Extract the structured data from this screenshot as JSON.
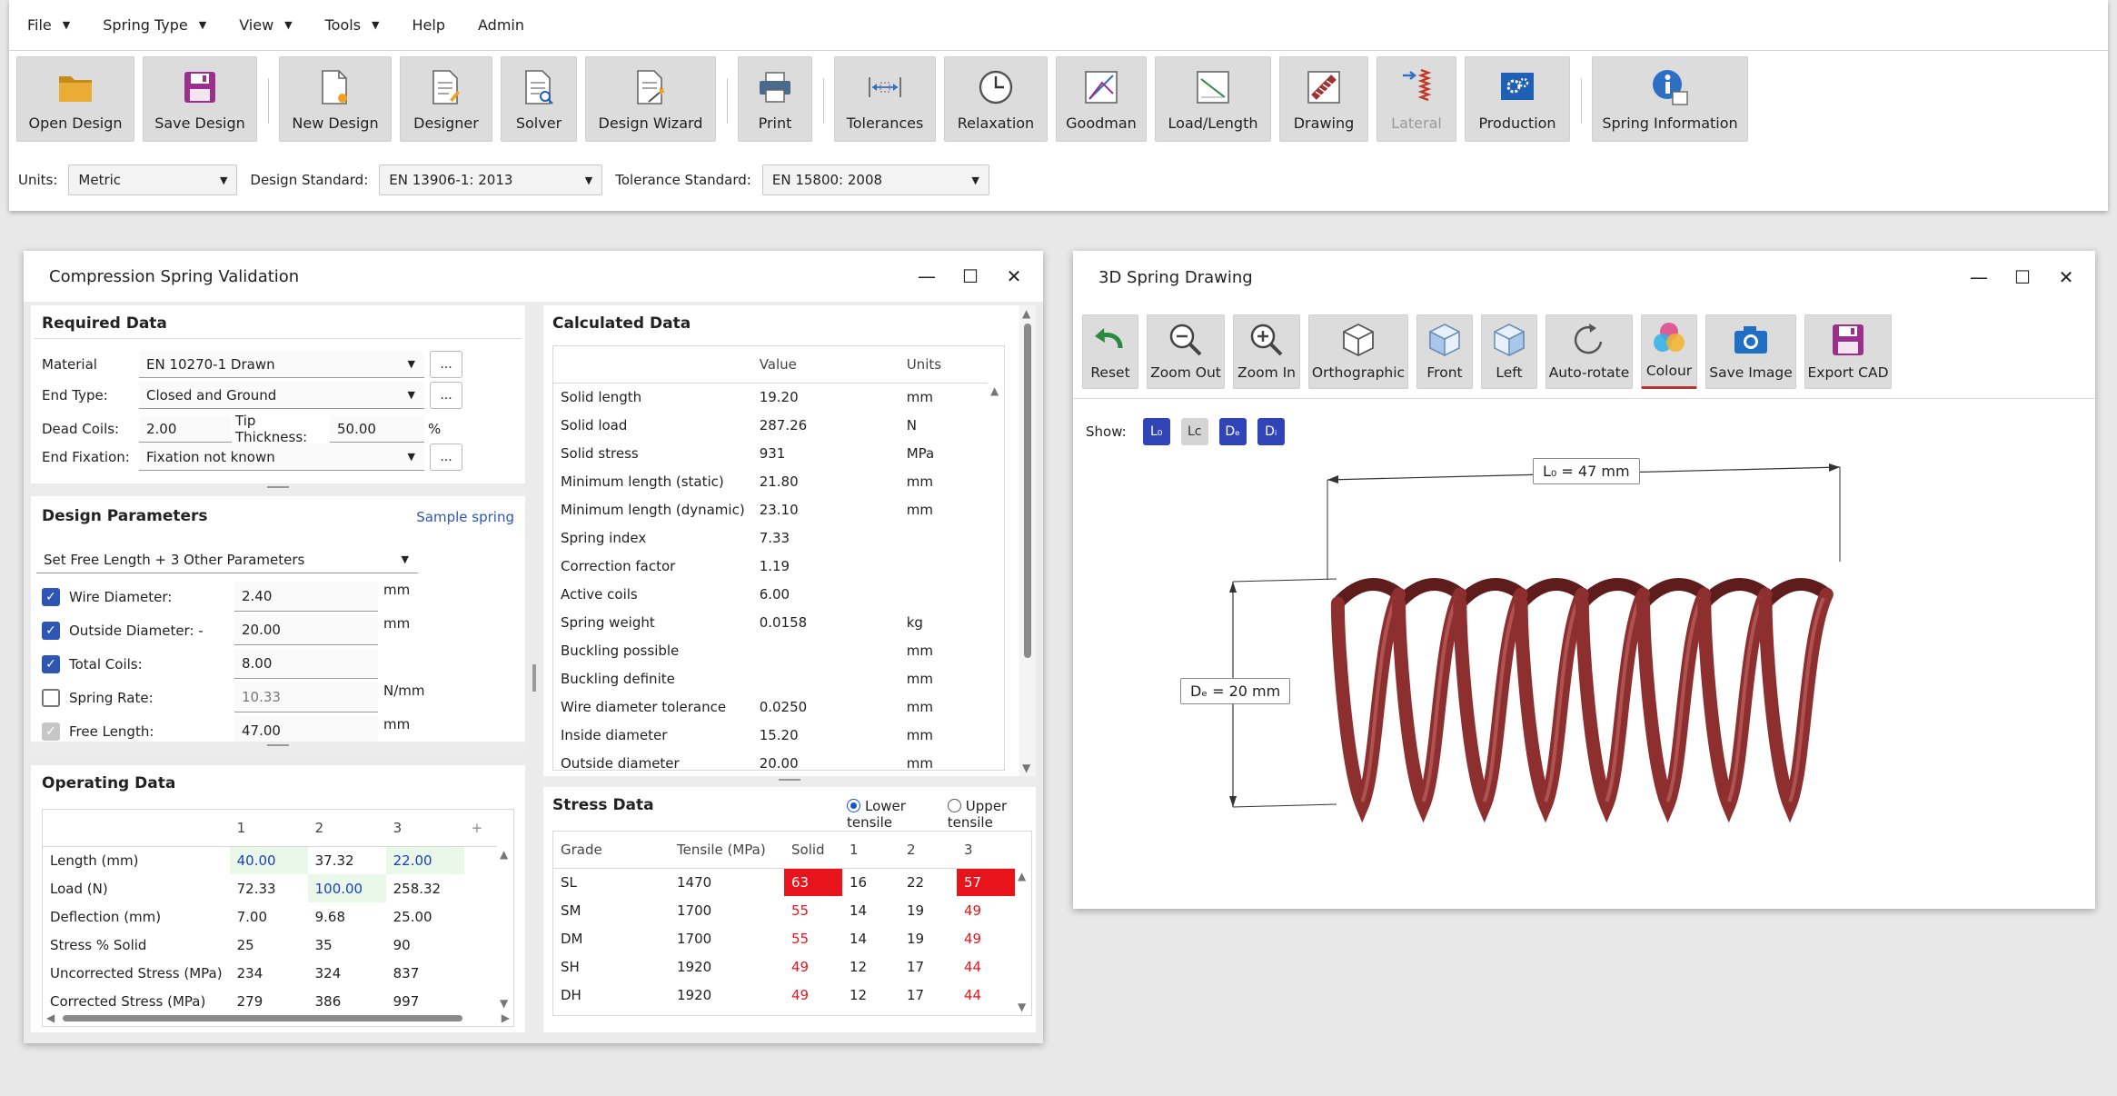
{
  "menus": [
    "File",
    "Spring Type",
    "View",
    "Tools",
    "Help",
    "Admin"
  ],
  "ribbon": {
    "open": "Open Design",
    "save": "Save Design",
    "new": "New Design",
    "designer": "Designer",
    "solver": "Solver",
    "wizard": "Design Wizard",
    "print": "Print",
    "tolerances": "Tolerances",
    "relaxation": "Relaxation",
    "goodman": "Goodman",
    "loadlength": "Load/Length",
    "drawing": "Drawing",
    "lateral": "Lateral",
    "production": "Production",
    "info": "Spring Information"
  },
  "units_bar": {
    "units_label": "Units:",
    "units_value": "Metric",
    "design_label": "Design Standard:",
    "design_value": "EN 13906-1: 2013",
    "tol_label": "Tolerance Standard:",
    "tol_value": "EN 15800: 2008"
  },
  "validation": {
    "title": "Compression Spring Validation",
    "required": {
      "title": "Required Data",
      "material_label": "Material",
      "material_value": "EN 10270-1 Drawn",
      "endtype_label": "End Type:",
      "endtype_value": "Closed and Ground",
      "dead_label": "Dead Coils:",
      "dead_value": "2.00",
      "tip_label": "Tip Thickness:",
      "tip_value": "50.00",
      "tip_unit": "%",
      "fix_label": "End Fixation:",
      "fix_value": "Fixation not known",
      "dots": "..."
    },
    "params": {
      "title": "Design Parameters",
      "sample": "Sample spring",
      "mode": "Set Free Length + 3 Other Parameters",
      "rows": [
        {
          "label": "Wire Diameter:",
          "value": "2.40",
          "unit": "mm"
        },
        {
          "label": "Outside Diameter: -",
          "value": "20.00",
          "unit": "mm"
        },
        {
          "label": "Total Coils:",
          "value": "8.00",
          "unit": ""
        },
        {
          "label": "Spring Rate:",
          "value": "10.33",
          "unit": "N/mm"
        },
        {
          "label": "Free Length:",
          "value": "47.00",
          "unit": "mm"
        }
      ]
    },
    "operating": {
      "title": "Operating Data",
      "headers": [
        "",
        "1",
        "2",
        "3",
        "+"
      ],
      "rows": [
        [
          "Length (mm)",
          "40.00",
          "37.32",
          "22.00"
        ],
        [
          "Load (N)",
          "72.33",
          "100.00",
          "258.32"
        ],
        [
          "Deflection (mm)",
          "7.00",
          "9.68",
          "25.00"
        ],
        [
          "Stress % Solid",
          "25",
          "35",
          "90"
        ],
        [
          "Uncorrected Stress (MPa)",
          "234",
          "324",
          "837"
        ],
        [
          "Corrected Stress (MPa)",
          "279",
          "386",
          "997"
        ]
      ]
    },
    "calculated": {
      "title": "Calculated Data",
      "headers": [
        "",
        "Value",
        "Units"
      ],
      "rows": [
        [
          "Solid length",
          "19.20",
          "mm"
        ],
        [
          "Solid load",
          "287.26",
          "N"
        ],
        [
          "Solid stress",
          "931",
          "MPa"
        ],
        [
          "Minimum length (static)",
          "21.80",
          "mm"
        ],
        [
          "Minimum length (dynamic)",
          "23.10",
          "mm"
        ],
        [
          "Spring index",
          "7.33",
          ""
        ],
        [
          "Correction factor",
          "1.19",
          ""
        ],
        [
          "Active coils",
          "6.00",
          ""
        ],
        [
          "Spring weight",
          "0.0158",
          "kg"
        ],
        [
          "Buckling possible",
          "",
          "mm"
        ],
        [
          "Buckling definite",
          "",
          "mm"
        ],
        [
          "Wire diameter tolerance",
          "0.0250",
          "mm"
        ],
        [
          "Inside diameter",
          "15.20",
          "mm"
        ],
        [
          "Outside diameter",
          "20.00",
          "mm"
        ]
      ]
    },
    "stress": {
      "title": "Stress Data",
      "lower": "Lower tensile",
      "upper": "Upper tensile",
      "headers": [
        "Grade",
        "Tensile (MPa)",
        "Solid",
        "1",
        "2",
        "3"
      ],
      "rows": [
        [
          "SL",
          "1470",
          "63",
          "16",
          "22",
          "57"
        ],
        [
          "SM",
          "1700",
          "55",
          "14",
          "19",
          "49"
        ],
        [
          "DM",
          "1700",
          "55",
          "14",
          "19",
          "49"
        ],
        [
          "SH",
          "1920",
          "49",
          "12",
          "17",
          "44"
        ],
        [
          "DH",
          "1920",
          "49",
          "12",
          "17",
          "44"
        ]
      ]
    }
  },
  "drawing": {
    "title": "3D Spring Drawing",
    "tools": {
      "reset": "Reset",
      "zoomout": "Zoom Out",
      "zoomin": "Zoom In",
      "ortho": "Orthographic",
      "front": "Front",
      "left": "Left",
      "autorotate": "Auto-rotate",
      "colour": "Colour",
      "saveimage": "Save Image",
      "exportcad": "Export CAD"
    },
    "show_label": "Show:",
    "show_buttons": [
      {
        "text": "L₀",
        "on": true
      },
      {
        "text": "Lc",
        "on": false
      },
      {
        "text": "Dₑ",
        "on": true
      },
      {
        "text": "Dᵢ",
        "on": true
      }
    ],
    "length_dim": "L₀ = 47 mm",
    "dia_dim": "Dₑ = 20 mm",
    "spring_color": "#8e2f2f"
  },
  "colors": {
    "accent": "#2d56b4",
    "warn": "#e8141c",
    "entered": "#1a3fc4"
  }
}
